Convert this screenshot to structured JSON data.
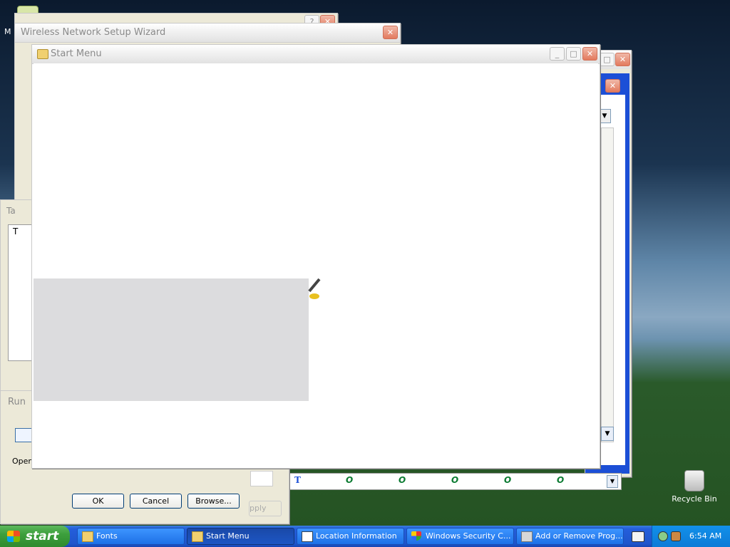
{
  "colors": {
    "taskbar": "#245edb",
    "start_green": "#3c9f3c",
    "close_red": "#e37a5e",
    "inactive_title_text": "#8a8a8a",
    "window_bg": "#ece9d8"
  },
  "desktop": {
    "icons": [
      {
        "label": "M",
        "icon": "my-computer-icon"
      },
      {
        "label": "Recycle Bin",
        "icon": "recycle-bin-icon"
      }
    ]
  },
  "windows": {
    "wireless": {
      "title": "Wireless Network Setup Wizard"
    },
    "start_menu": {
      "title": "Start Menu"
    },
    "tab_window": {
      "title_fragment": "Ta",
      "item_fragment": "T"
    },
    "run": {
      "title": "Run",
      "open_label": "Open",
      "ok": "OK",
      "cancel": "Cancel",
      "browse": "Browse...",
      "apply_fragment": "pply"
    }
  },
  "taskbar": {
    "start_label": "start",
    "tasks": [
      {
        "label": "Fonts",
        "icon": "folder-icon",
        "active": false
      },
      {
        "label": "Start Menu",
        "icon": "folder-icon",
        "active": true
      },
      {
        "label": "Location Information",
        "icon": "window-icon",
        "active": false
      },
      {
        "label": "Windows Security C...",
        "icon": "shield-icon",
        "active": false
      },
      {
        "label": "Add or Remove Prog...",
        "icon": "add-remove-icon",
        "active": false
      }
    ],
    "clock": "6:54 AM"
  }
}
